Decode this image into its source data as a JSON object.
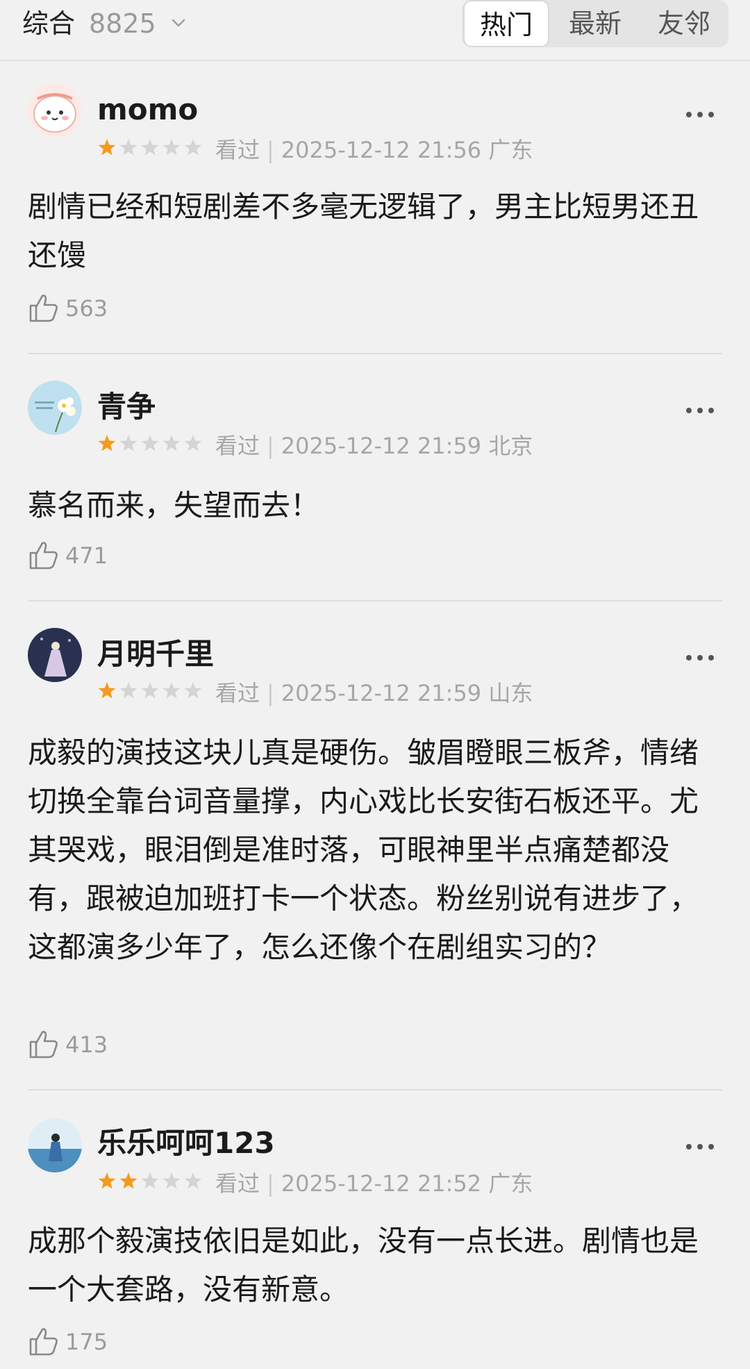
{
  "header": {
    "sort_label": "综合",
    "count": "8825",
    "tabs": [
      {
        "label": "热门",
        "active": true
      },
      {
        "label": "最新",
        "active": false
      },
      {
        "label": "友邻",
        "active": false
      }
    ]
  },
  "colors": {
    "star_filled": "#f59a1c",
    "star_empty": "#d4d4d4",
    "background": "#f1f1f1"
  },
  "comments": [
    {
      "username": "momo",
      "rating": 1,
      "status": "看过",
      "datetime": "2025-12-12 21:56",
      "location": "广东",
      "text": "剧情已经和短剧差不多毫无逻辑了，男主比短男还丑还馒",
      "likes": "563"
    },
    {
      "username": "青争",
      "rating": 1,
      "status": "看过",
      "datetime": "2025-12-12 21:59",
      "location": "北京",
      "text": "慕名而来，失望而去！",
      "likes": "471"
    },
    {
      "username": "月明千里",
      "rating": 1,
      "status": "看过",
      "datetime": "2025-12-12 21:59",
      "location": "山东",
      "text": "成毅的演技这块儿真是硬伤。皱眉瞪眼三板斧，情绪切换全靠台词音量撑，内心戏比长安街石板还平。尤其哭戏，眼泪倒是准时落，可眼神里半点痛楚都没有，跟被迫加班打卡一个状态。粉丝别说有进步了，这都演多少年了，怎么还像个在剧组实习的？",
      "likes": "413"
    },
    {
      "username": "乐乐呵呵123",
      "rating": 2,
      "status": "看过",
      "datetime": "2025-12-12 21:52",
      "location": "广东",
      "text": "成那个毅演技依旧是如此，没有一点长进。剧情也是一个大套路，没有新意。",
      "likes": "175"
    }
  ]
}
